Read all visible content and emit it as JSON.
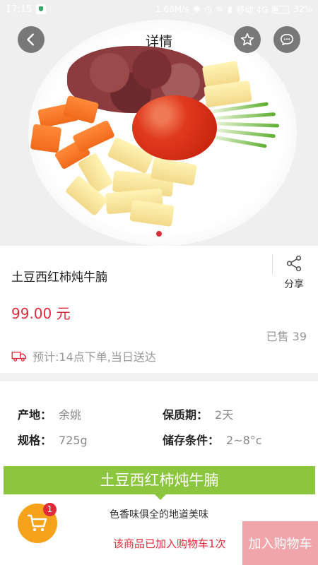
{
  "status_bar": {
    "time": "17:15",
    "network_speed": "1.68M/s",
    "carrier": "移动 4G",
    "battery": "32%"
  },
  "header": {
    "title": "详情",
    "back_icon": "chevron-left-icon",
    "favorite_icon": "star-icon",
    "message_icon": "chat-bubble-icon"
  },
  "gallery": {
    "slide_count": 3,
    "active_index": 1
  },
  "product": {
    "name": "土豆西红柿炖牛腩",
    "price": "99.00 元",
    "sold": "已售 39",
    "share_label": "分享",
    "delivery": "预计:14点下单,当日送达"
  },
  "specs": {
    "origin_label": "产地：",
    "origin_value": "余姚",
    "shelf_life_label": "保质期：",
    "shelf_life_value": "2天",
    "size_label": "规格：",
    "size_value": "725g",
    "storage_label": "储存条件：",
    "storage_value": "2~8°c"
  },
  "promo": {
    "banner_title": "土豆西红柿炖牛腩",
    "slogan": "色香味俱全的地道美味"
  },
  "bottom_bar": {
    "cart_count": "1",
    "added_notice": "该商品已加入购物车1次",
    "add_to_cart_label": "加入购物车"
  },
  "colors": {
    "accent_red": "#e02b3a",
    "banner_green": "#8cc63f",
    "cart_orange": "#f7a21b",
    "add_button_pink": "#f0a5aa"
  }
}
